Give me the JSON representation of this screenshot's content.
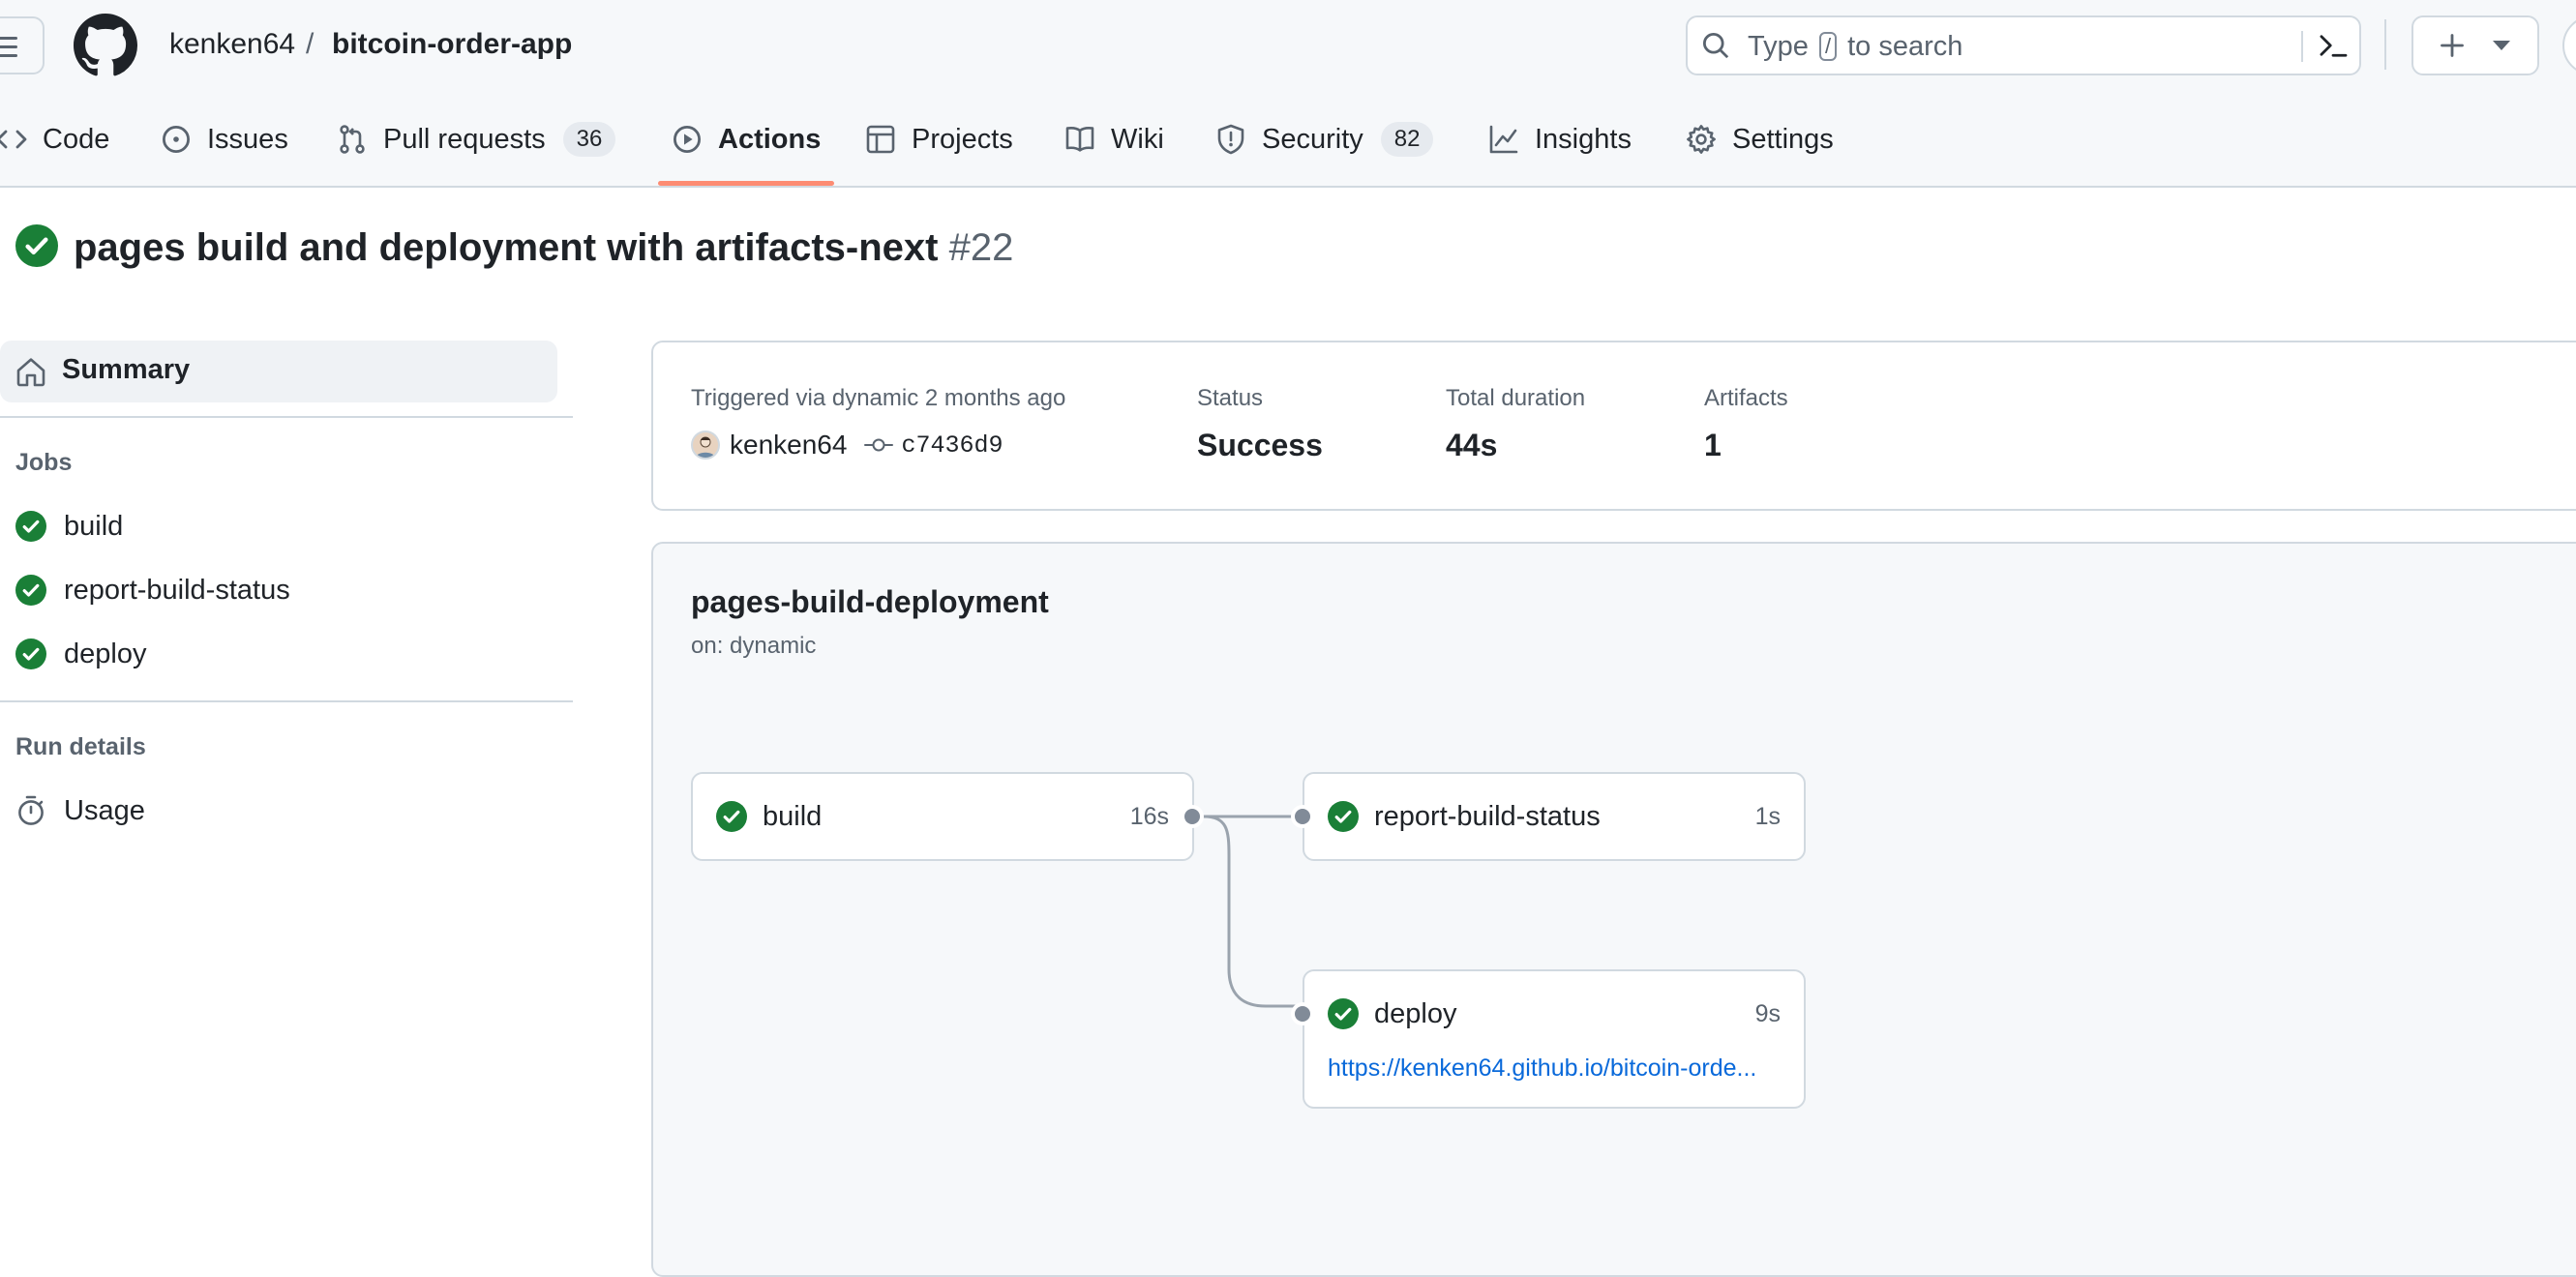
{
  "header": {
    "owner": "kenken64",
    "separator": "/",
    "repo": "bitcoin-order-app",
    "search_prefix": "Type",
    "search_key": "/",
    "search_suffix": "to search",
    "icons": [
      "hamburger-icon",
      "github-logo-icon",
      "search-icon",
      "command-palette-icon",
      "plus-icon",
      "triangle-down-icon"
    ]
  },
  "tabs": [
    {
      "label": "Code",
      "icon": "code-icon"
    },
    {
      "label": "Issues",
      "icon": "issue-icon"
    },
    {
      "label": "Pull requests",
      "count": "36",
      "icon": "pull-request-icon"
    },
    {
      "label": "Actions",
      "icon": "play-icon",
      "active": true
    },
    {
      "label": "Projects",
      "icon": "table-icon"
    },
    {
      "label": "Wiki",
      "icon": "book-icon"
    },
    {
      "label": "Security",
      "count": "82",
      "icon": "shield-icon"
    },
    {
      "label": "Insights",
      "icon": "graph-icon"
    },
    {
      "label": "Settings",
      "icon": "gear-icon"
    }
  ],
  "run": {
    "title": "pages build and deployment with artifacts-next",
    "number": "#22"
  },
  "sidebar": {
    "summary": "Summary",
    "jobs_heading": "Jobs",
    "jobs": [
      "build",
      "report-build-status",
      "deploy"
    ],
    "run_details_heading": "Run details",
    "usage": "Usage"
  },
  "summary": {
    "trigger_label": "Triggered via dynamic 2 months ago",
    "actor": "kenken64",
    "commit": "c7436d9",
    "status_label": "Status",
    "status_value": "Success",
    "duration_label": "Total duration",
    "duration_value": "44s",
    "artifacts_label": "Artifacts",
    "artifacts_value": "1"
  },
  "workflow": {
    "name": "pages-build-deployment",
    "trigger": "on: dynamic",
    "jobs": [
      {
        "name": "build",
        "duration": "16s"
      },
      {
        "name": "report-build-status",
        "duration": "1s"
      },
      {
        "name": "deploy",
        "duration": "9s",
        "url": "https://kenken64.github.io/bitcoin-orde..."
      }
    ]
  },
  "colors": {
    "success": "#1a7f37",
    "accent_underline": "#fd8c73",
    "link": "#0969da"
  }
}
